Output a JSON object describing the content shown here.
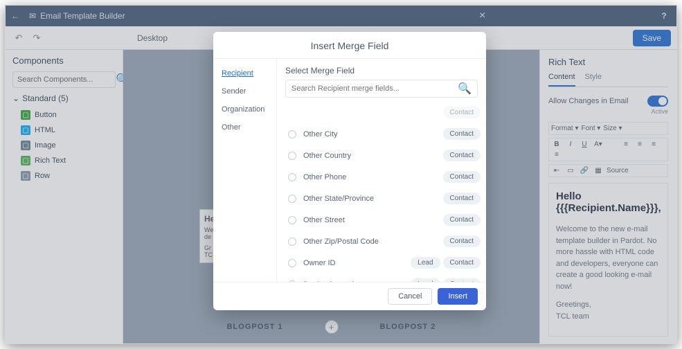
{
  "header": {
    "title": "Email Template Builder",
    "help": "?"
  },
  "toolbar": {
    "viewport": "Desktop",
    "save": "Save"
  },
  "leftpane": {
    "title": "Components",
    "search_placeholder": "Search Components...",
    "accordion": "Standard (5)",
    "items": [
      {
        "label": "Button",
        "color": "#4caf50"
      },
      {
        "label": "HTML",
        "color": "#29b6f6"
      },
      {
        "label": "Image",
        "color": "#78909c"
      },
      {
        "label": "Rich Text",
        "color": "#66bb6a"
      },
      {
        "label": "Row",
        "color": "#90a4ae"
      }
    ]
  },
  "canvas": {
    "stub_title": "He",
    "stub_l1": "We",
    "stub_l2": "de",
    "stub_l3": "Gr",
    "stub_l4": "TC",
    "blog1": "BLOGPOST 1",
    "blog2": "BLOGPOST 2"
  },
  "rightpane": {
    "title": "Rich Text",
    "tabs": {
      "content": "Content",
      "style": "Style"
    },
    "allow": "Allow Changes in Email",
    "active": "Active",
    "heading": "Hello {{{Recipient.Name}}},",
    "body": "Welcome to the new e-mail template builder in Pardot. No more hassle with HTML code and developers, everyone can create a good looking e-mail now!",
    "greet": "Greetings,",
    "team": "TCL team"
  },
  "modal": {
    "title": "Insert Merge Field",
    "close": "×",
    "cats": [
      "Recipient",
      "Sender",
      "Organization",
      "Other"
    ],
    "select_label": "Select Merge Field",
    "search_placeholder": "Search Recipient merge fields...",
    "fields": [
      {
        "name": "Other City",
        "tags": [
          "Contact"
        ]
      },
      {
        "name": "Other Country",
        "tags": [
          "Contact"
        ]
      },
      {
        "name": "Other Phone",
        "tags": [
          "Contact"
        ]
      },
      {
        "name": "Other State/Province",
        "tags": [
          "Contact"
        ]
      },
      {
        "name": "Other Street",
        "tags": [
          "Contact"
        ]
      },
      {
        "name": "Other Zip/Postal Code",
        "tags": [
          "Contact"
        ]
      },
      {
        "name": "Owner ID",
        "tags": [
          "Lead",
          "Contact"
        ]
      },
      {
        "name": "Pardot Campaign",
        "tags": [
          "Lead",
          "Contact"
        ]
      }
    ],
    "cancel": "Cancel",
    "insert": "Insert"
  }
}
